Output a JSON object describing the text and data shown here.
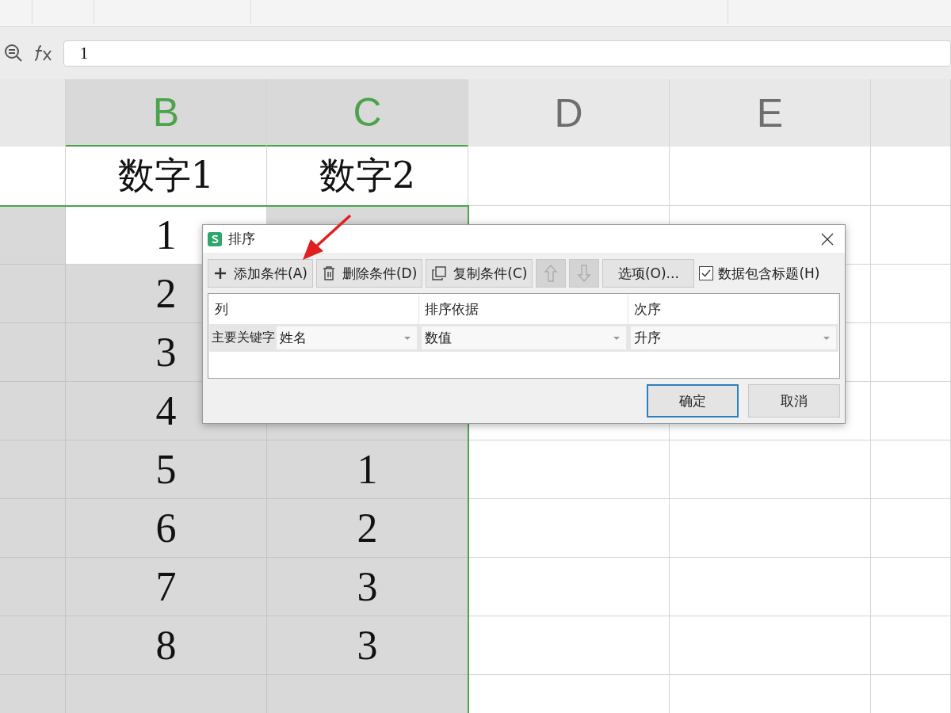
{
  "formula_bar": {
    "value": "1"
  },
  "columns": [
    {
      "label": "B",
      "selected": true
    },
    {
      "label": "C",
      "selected": true
    },
    {
      "label": "D",
      "selected": false
    },
    {
      "label": "E",
      "selected": false
    }
  ],
  "rows": [
    {
      "b": "数字1",
      "c": "数字2",
      "kind": "header"
    },
    {
      "b": "1",
      "kind": "number",
      "active": true
    },
    {
      "b": "2",
      "kind": "number",
      "active": false
    },
    {
      "b": "3",
      "kind": "number",
      "active": false
    },
    {
      "b": "4",
      "kind": "number",
      "active": false
    },
    {
      "b": "5",
      "c": "1",
      "kind": "number",
      "active": false
    },
    {
      "b": "6",
      "c": "2",
      "kind": "number",
      "active": false
    },
    {
      "b": "7",
      "c": "3",
      "kind": "number",
      "active": false
    },
    {
      "b": "8",
      "c": "3",
      "kind": "number",
      "active": false
    },
    {
      "kind": "number",
      "active": false
    }
  ],
  "dialog": {
    "title": "排序",
    "tools": [
      {
        "kind": "add",
        "label": "添加条件(A)"
      },
      {
        "kind": "delete",
        "label": "删除条件(D)"
      },
      {
        "kind": "copy",
        "label": "复制条件(C)"
      },
      {
        "kind": "up",
        "disabled": true
      },
      {
        "kind": "down",
        "disabled": true
      },
      {
        "kind": "text",
        "label": "选项(O)..."
      }
    ],
    "header_checkbox": {
      "label": "数据包含标题(H)",
      "checked": true
    },
    "table_columns": [
      "列",
      "排序依据",
      "次序"
    ],
    "condition": {
      "label": "主要关键字",
      "column": "姓名",
      "basis": "数值",
      "order": "升序"
    },
    "buttons": [
      {
        "label": "确定",
        "primary": true
      },
      {
        "label": "取消",
        "primary": false
      }
    ]
  }
}
